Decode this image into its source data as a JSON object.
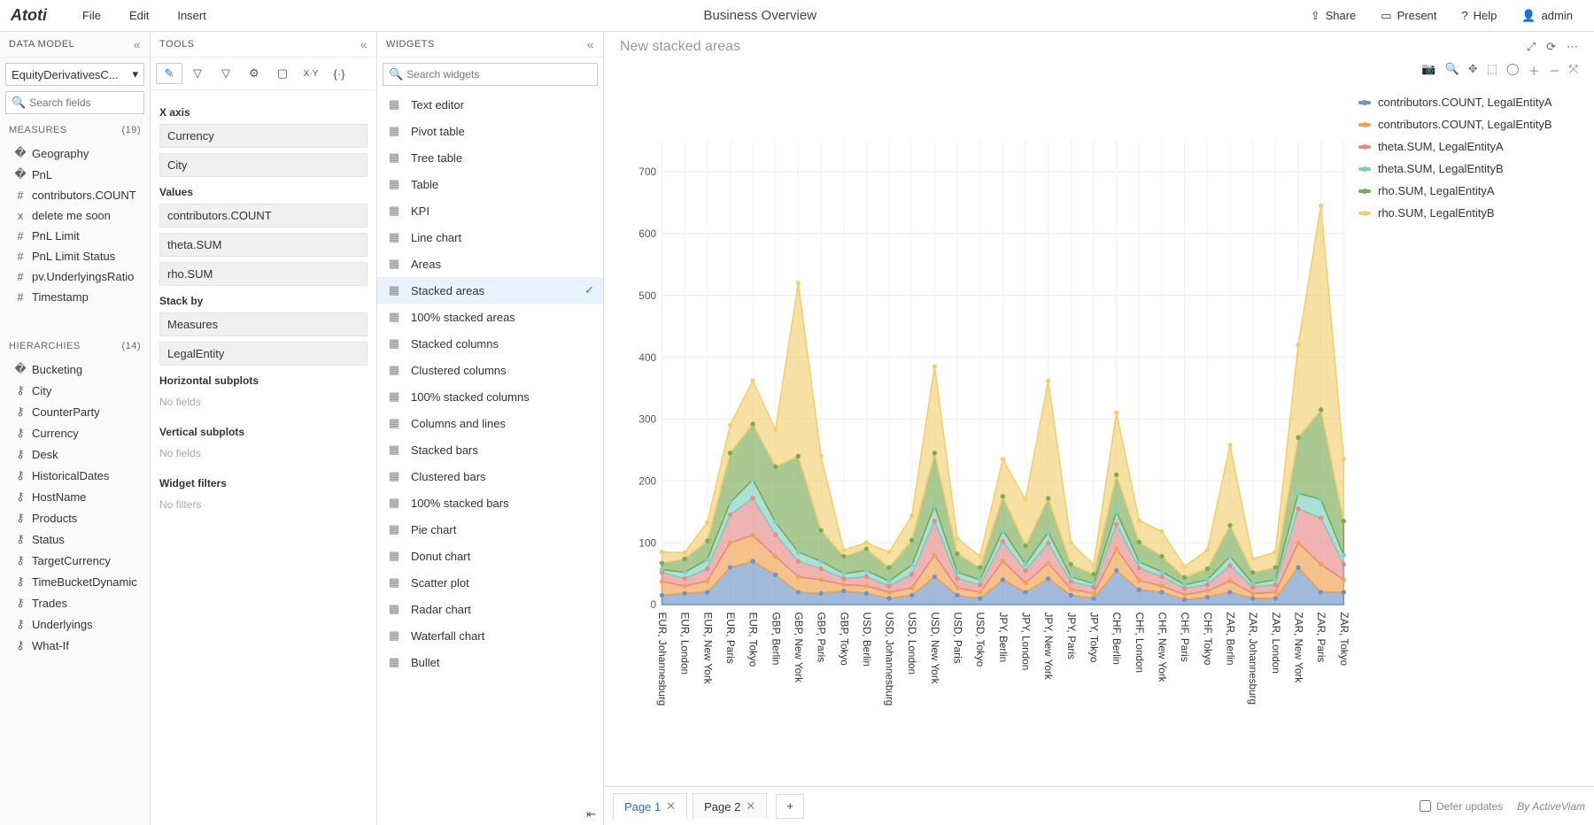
{
  "app_name": "Atoti",
  "menubar": {
    "file": "File",
    "edit": "Edit",
    "insert": "Insert"
  },
  "title": "Business Overview",
  "menubar_right": {
    "share": "Share",
    "present": "Present",
    "help": "Help",
    "user": "admin"
  },
  "data_model": {
    "title": "DATA MODEL",
    "cube": "EquityDerivativesC...",
    "search_placeholder": "Search fields",
    "measures_title": "MEASURES",
    "measures_count": "(19)",
    "measures": [
      {
        "type": "folder",
        "label": "Geography"
      },
      {
        "type": "folder",
        "label": "PnL"
      },
      {
        "type": "hash",
        "label": "contributors.COUNT"
      },
      {
        "type": "fx",
        "label": "delete me soon"
      },
      {
        "type": "hash",
        "label": "PnL Limit"
      },
      {
        "type": "hash",
        "label": "PnL Limit Status"
      },
      {
        "type": "hash",
        "label": "pv.UnderlyingsRatio"
      },
      {
        "type": "hash",
        "label": "Timestamp"
      }
    ],
    "hierarchies_title": "HIERARCHIES",
    "hierarchies_count": "(14)",
    "hierarchies": [
      {
        "type": "folder",
        "label": "Bucketing"
      },
      {
        "type": "hier",
        "label": "City"
      },
      {
        "type": "hier",
        "label": "CounterParty"
      },
      {
        "type": "hier",
        "label": "Currency"
      },
      {
        "type": "hier",
        "label": "Desk"
      },
      {
        "type": "hier",
        "label": "HistoricalDates"
      },
      {
        "type": "hier",
        "label": "HostName"
      },
      {
        "type": "hier",
        "label": "Products"
      },
      {
        "type": "hier",
        "label": "Status"
      },
      {
        "type": "hier",
        "label": "TargetCurrency"
      },
      {
        "type": "hier",
        "label": "TimeBucketDynamic"
      },
      {
        "type": "hier",
        "label": "Trades"
      },
      {
        "type": "hier",
        "label": "Underlyings"
      },
      {
        "type": "hier",
        "label": "What-If"
      }
    ]
  },
  "tools": {
    "title": "TOOLS",
    "sections": {
      "xaxis_label": "X axis",
      "xaxis": [
        "Currency",
        "City"
      ],
      "values_label": "Values",
      "values": [
        "contributors.COUNT",
        "theta.SUM",
        "rho.SUM"
      ],
      "stack_label": "Stack by",
      "stack": [
        "Measures",
        "LegalEntity"
      ],
      "hsub_label": "Horizontal subplots",
      "hsub_hint": "No fields",
      "vsub_label": "Vertical subplots",
      "vsub_hint": "No fields",
      "filters_label": "Widget filters",
      "filters_hint": "No filters"
    }
  },
  "widgets": {
    "title": "WIDGETS",
    "search_placeholder": "Search widgets",
    "list": [
      "Text editor",
      "Pivot table",
      "Tree table",
      "Table",
      "KPI",
      "Line chart",
      "Areas",
      "Stacked areas",
      "100% stacked areas",
      "Stacked columns",
      "Clustered columns",
      "100% stacked columns",
      "Columns and lines",
      "Stacked bars",
      "Clustered bars",
      "100% stacked bars",
      "Pie chart",
      "Donut chart",
      "Scatter plot",
      "Radar chart",
      "Waterfall chart",
      "Bullet"
    ],
    "selected": "Stacked areas"
  },
  "canvas": {
    "chart_title": "New stacked areas",
    "legend": [
      {
        "label": "contributors.COUNT, LegalEntityA",
        "color": "#6e93c8"
      },
      {
        "label": "contributors.COUNT, LegalEntityB",
        "color": "#f0a24e"
      },
      {
        "label": "theta.SUM, LegalEntityA",
        "color": "#e78b87"
      },
      {
        "label": "theta.SUM, LegalEntityB",
        "color": "#7ecfc0"
      },
      {
        "label": "rho.SUM, LegalEntityA",
        "color": "#7cab56"
      },
      {
        "label": "rho.SUM, LegalEntityB",
        "color": "#f2cf72"
      }
    ]
  },
  "pager": {
    "pages": [
      "Page 1",
      "Page 2"
    ],
    "active": 0,
    "defer": "Defer updates",
    "byline": "By ActiveViam"
  },
  "chart_data": {
    "type": "area",
    "title": "New stacked areas",
    "ylim": [
      0,
      750
    ],
    "yticks": [
      0,
      100,
      200,
      300,
      400,
      500,
      600,
      700
    ],
    "categories": [
      "EUR, Johannesburg",
      "EUR, London",
      "EUR, New York",
      "EUR, Paris",
      "EUR, Tokyo",
      "GBP, Berlin",
      "GBP, New York",
      "GBP, Paris",
      "GBP, Tokyo",
      "USD, Berlin",
      "USD, Johannesburg",
      "USD, London",
      "USD, New York",
      "USD, Paris",
      "USD, Tokyo",
      "JPY, Berlin",
      "JPY, London",
      "JPY, New York",
      "JPY, Paris",
      "JPY, Tokyo",
      "CHF, Berlin",
      "CHF, London",
      "CHF, New York",
      "CHF, Paris",
      "CHF, Tokyo",
      "ZAR, Berlin",
      "ZAR, Johannesburg",
      "ZAR, London",
      "ZAR, New York",
      "ZAR, Paris",
      "ZAR, Tokyo"
    ],
    "series": [
      {
        "name": "contributors.COUNT, LegalEntityA",
        "color": "#6e93c8",
        "values": [
          15,
          18,
          20,
          60,
          70,
          48,
          20,
          18,
          22,
          18,
          10,
          15,
          45,
          15,
          10,
          40,
          20,
          42,
          15,
          10,
          55,
          24,
          20,
          8,
          12,
          20,
          10,
          10,
          60,
          20,
          20
        ]
      },
      {
        "name": "contributors.COUNT, LegalEntityB",
        "color": "#f0a24e",
        "values": [
          22,
          12,
          18,
          40,
          42,
          30,
          25,
          22,
          10,
          12,
          10,
          12,
          35,
          12,
          10,
          30,
          15,
          25,
          10,
          8,
          35,
          15,
          10,
          8,
          10,
          18,
          8,
          10,
          40,
          45,
          20
        ]
      },
      {
        "name": "theta.SUM, LegalEntityA",
        "color": "#e78b87",
        "values": [
          15,
          12,
          20,
          45,
          60,
          35,
          25,
          18,
          10,
          15,
          10,
          22,
          55,
          15,
          12,
          32,
          20,
          32,
          12,
          10,
          40,
          20,
          15,
          10,
          10,
          25,
          10,
          12,
          55,
          75,
          25
        ]
      },
      {
        "name": "theta.SUM, LegalEntityB",
        "color": "#7ecfc0",
        "values": [
          5,
          10,
          15,
          20,
          30,
          20,
          15,
          12,
          8,
          10,
          8,
          15,
          25,
          10,
          8,
          18,
          10,
          18,
          8,
          6,
          20,
          10,
          8,
          6,
          8,
          15,
          6,
          8,
          25,
          30,
          15
        ]
      },
      {
        "name": "rho.SUM, LegalEntityA",
        "color": "#7cab56",
        "values": [
          10,
          22,
          30,
          80,
          90,
          90,
          155,
          50,
          28,
          35,
          22,
          40,
          85,
          30,
          20,
          55,
          30,
          55,
          20,
          15,
          60,
          32,
          25,
          12,
          18,
          50,
          18,
          20,
          90,
          145,
          55
        ]
      },
      {
        "name": "rho.SUM, LegalEntityB",
        "color": "#f2cf72",
        "values": [
          18,
          10,
          30,
          45,
          70,
          60,
          280,
          120,
          10,
          10,
          25,
          40,
          140,
          25,
          18,
          60,
          75,
          190,
          35,
          15,
          100,
          35,
          40,
          18,
          30,
          130,
          22,
          25,
          150,
          330,
          100
        ]
      }
    ]
  }
}
